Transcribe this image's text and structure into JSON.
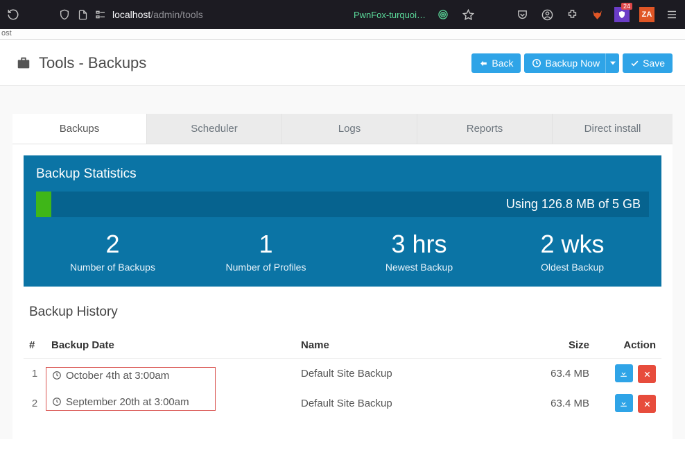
{
  "browser": {
    "url_host": "localhost",
    "url_path": "/admin/tools",
    "ext_label": "PwnFox-turquoi…",
    "badge_icon_num": "24",
    "za_label": "ZA"
  },
  "secrow": {
    "text": "ost"
  },
  "header": {
    "title": "Tools - Backups",
    "back": "Back",
    "backup_now": "Backup Now",
    "save": "Save"
  },
  "tabs": [
    {
      "label": "Backups",
      "active": true
    },
    {
      "label": "Scheduler",
      "active": false
    },
    {
      "label": "Logs",
      "active": false
    },
    {
      "label": "Reports",
      "active": false
    },
    {
      "label": "Direct install",
      "active": false
    }
  ],
  "stats": {
    "title": "Backup Statistics",
    "usage_text": "Using 126.8 MB of 5 GB",
    "items": [
      {
        "value": "2",
        "label": "Number of Backups"
      },
      {
        "value": "1",
        "label": "Number of Profiles"
      },
      {
        "value": "3 hrs",
        "label": "Newest Backup"
      },
      {
        "value": "2 wks",
        "label": "Oldest Backup"
      }
    ]
  },
  "history": {
    "title": "Backup History",
    "columns": {
      "num": "#",
      "date": "Backup Date",
      "name": "Name",
      "size": "Size",
      "action": "Action"
    },
    "rows": [
      {
        "num": "1",
        "date": "October 4th at 3:00am",
        "name": "Default Site Backup",
        "size": "63.4 MB"
      },
      {
        "num": "2",
        "date": "September 20th at 3:00am",
        "name": "Default Site Backup",
        "size": "63.4 MB"
      }
    ]
  }
}
